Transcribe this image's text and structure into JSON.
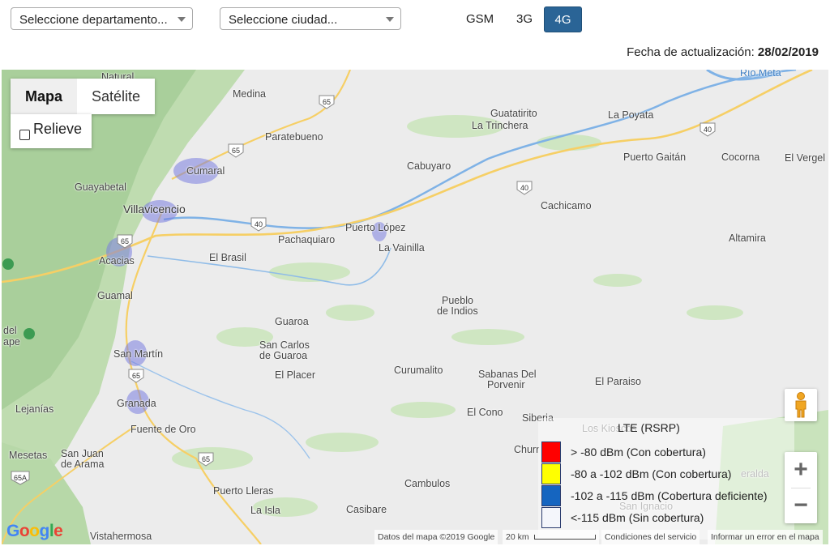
{
  "filters": {
    "department_placeholder": "Seleccione departamento...",
    "city_placeholder": "Seleccione ciudad..."
  },
  "network_tabs": [
    {
      "label": "GSM",
      "active": false
    },
    {
      "label": "3G",
      "active": false
    },
    {
      "label": "4G",
      "active": true
    }
  ],
  "update": {
    "label": "Fecha de actualización:",
    "date": "28/02/2019"
  },
  "map": {
    "map_type_buttons": [
      "Mapa",
      "Satélite"
    ],
    "relief_label": "Relieve",
    "places": [
      "Natural",
      "Medina",
      "Guatatirito",
      "La Trinchera",
      "La Poyata",
      "Paratebueno",
      "Cumaral",
      "Cabuyaro",
      "Puerto Gaitán",
      "Cocorna",
      "El Vergel",
      "Guayabetal",
      "Villavicencio",
      "Cachicamo",
      "Puerto López",
      "La Vainilla",
      "Pachaquiaro",
      "Acacias",
      "El Brasil",
      "Altamira",
      "Guamal",
      "Pueblo",
      "de Indios",
      "Guaroa",
      "San Carlos",
      "de Guaroa",
      "San Martín",
      "El Placer",
      "Curumalito",
      "Sabanas Del",
      "Porvenir",
      "El Paraiso",
      "Granada",
      "Lejanías",
      "Fuente de Oro",
      "El Cono",
      "Siberia",
      "Los Kioscos",
      "Churr",
      "Mesetas",
      "San Juan",
      "de Arama",
      "Cambulos",
      "San Ignacio",
      "Puerto Lleras",
      "La Isla",
      "Casibare",
      "Vistahermosa",
      "del",
      "ape",
      "Río Meta",
      "eralda"
    ],
    "road_shields": [
      "65",
      "65",
      "40",
      "40",
      "40",
      "65",
      "65",
      "65",
      "65A"
    ],
    "legend": {
      "title": "LTE (RSRP)",
      "items": [
        {
          "label": "> -80 dBm (Con cobertura)",
          "color": "#ff0000"
        },
        {
          "label": "-80 a -102 dBm (Con cobertura)",
          "color": "#ffff00"
        },
        {
          "label": "-102 a -115 dBm (Cobertura deficiente)",
          "color": "#1565c0"
        },
        {
          "label": "<-115 dBm (Sin cobertura)",
          "color": "#f4f6fb"
        }
      ]
    },
    "google_logo": "Google",
    "attribution": "Datos del mapa ©2019 Google",
    "scale": "20 km",
    "terms": "Condiciones del servicio",
    "report": "Informar un error en el mapa"
  }
}
